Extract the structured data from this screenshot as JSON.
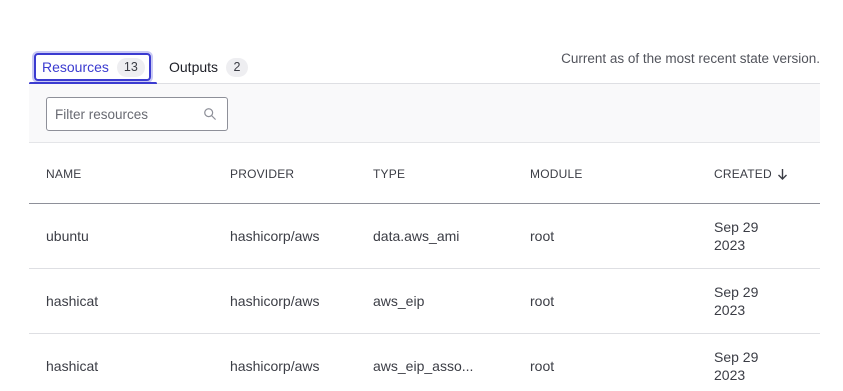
{
  "tabs": [
    {
      "label": "Resources",
      "count": "13"
    },
    {
      "label": "Outputs",
      "count": "2"
    }
  ],
  "note": "Current as of the most recent state version.",
  "filter": {
    "placeholder": "Filter resources"
  },
  "icons": {
    "search": "search-icon",
    "sort": "arrow-down-icon"
  },
  "colors": {
    "accent": "#3b3bd0"
  },
  "table": {
    "headers": [
      "NAME",
      "PROVIDER",
      "TYPE",
      "MODULE",
      "CREATED"
    ],
    "rows": [
      {
        "name": "ubuntu",
        "provider": "hashicorp/aws",
        "type": "data.aws_ami",
        "module": "root",
        "created_line1": "Sep 29",
        "created_line2": "2023"
      },
      {
        "name": "hashicat",
        "provider": "hashicorp/aws",
        "type": "aws_eip",
        "module": "root",
        "created_line1": "Sep 29",
        "created_line2": "2023"
      },
      {
        "name": "hashicat",
        "provider": "hashicorp/aws",
        "type": "aws_eip_asso...",
        "module": "root",
        "created_line1": "Sep 29",
        "created_line2": "2023"
      }
    ]
  }
}
